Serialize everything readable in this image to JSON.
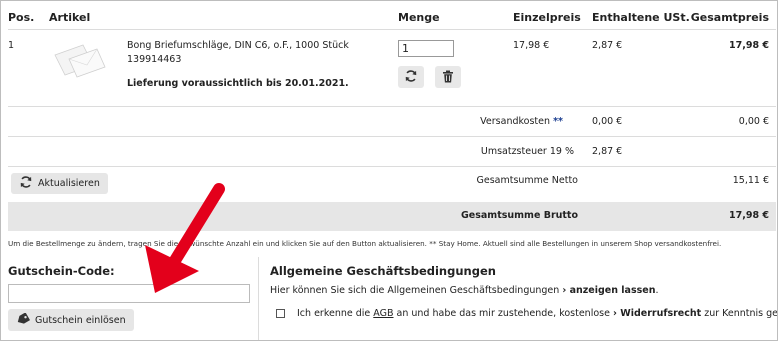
{
  "table": {
    "headers": {
      "pos": "Pos.",
      "artikel": "Artikel",
      "menge": "Menge",
      "einzelpreis": "Einzelpreis",
      "ust": "Enthaltene USt.",
      "gesamtpreis": "Gesamtpreis"
    },
    "rows": [
      {
        "pos": "1",
        "name": "Bong Briefumschläge, DIN C6, o.F., 1000 Stück",
        "sku": "139914463",
        "delivery": "Lieferung voraussichtlich bis 20.01.2021.",
        "quantity": "1",
        "einzelpreis": "17,98 €",
        "ust": "2,87 €",
        "gesamtpreis": "17,98 €"
      }
    ]
  },
  "summary": {
    "versand_label": "Versandkosten",
    "versand_marker": "**",
    "versand_ust": "0,00 €",
    "versand_total": "0,00 €",
    "ust_label": "Umsatzsteuer 19 %",
    "ust_value": "2,87 €",
    "netto_label": "Gesamtsumme Netto",
    "netto_value": "15,11 €",
    "brutto_label": "Gesamtsumme Brutto",
    "brutto_value": "17,98 €"
  },
  "buttons": {
    "aktualisieren": "Aktualisieren",
    "gutschein": "Gutschein einlösen"
  },
  "note": "Um die Bestellmenge zu ändern, tragen Sie die gewünschte Anzahl ein und klicken Sie auf den Button aktualisieren. ** Stay Home. Aktuell sind alle Bestellungen in unserem Shop versandkostenfrei.",
  "coupon": {
    "label": "Gutschein-Code:",
    "value": ""
  },
  "agb": {
    "title": "Allgemeine Geschäftsbedingungen",
    "text": "Hier können Sie sich die Allgemeinen Geschäftsbedingungen",
    "link_prefix": "›",
    "link_text": "anzeigen lassen",
    "link_suffix": ".",
    "check_pre": "Ich erkenne die",
    "check_agb": "AGB",
    "check_mid": "an und habe das mir zustehende, kostenlose",
    "check_link_prefix": "›",
    "check_link": "Widerrufsrecht",
    "check_post": "zur Kenntnis genommen."
  },
  "icons": {
    "refresh": "refresh-icon",
    "trash": "trash-icon",
    "tag": "tag-icon",
    "annotation_arrow": "red-arrow"
  },
  "colors": {
    "arrow": "#e3001b",
    "bar": "#e6e6e6"
  }
}
